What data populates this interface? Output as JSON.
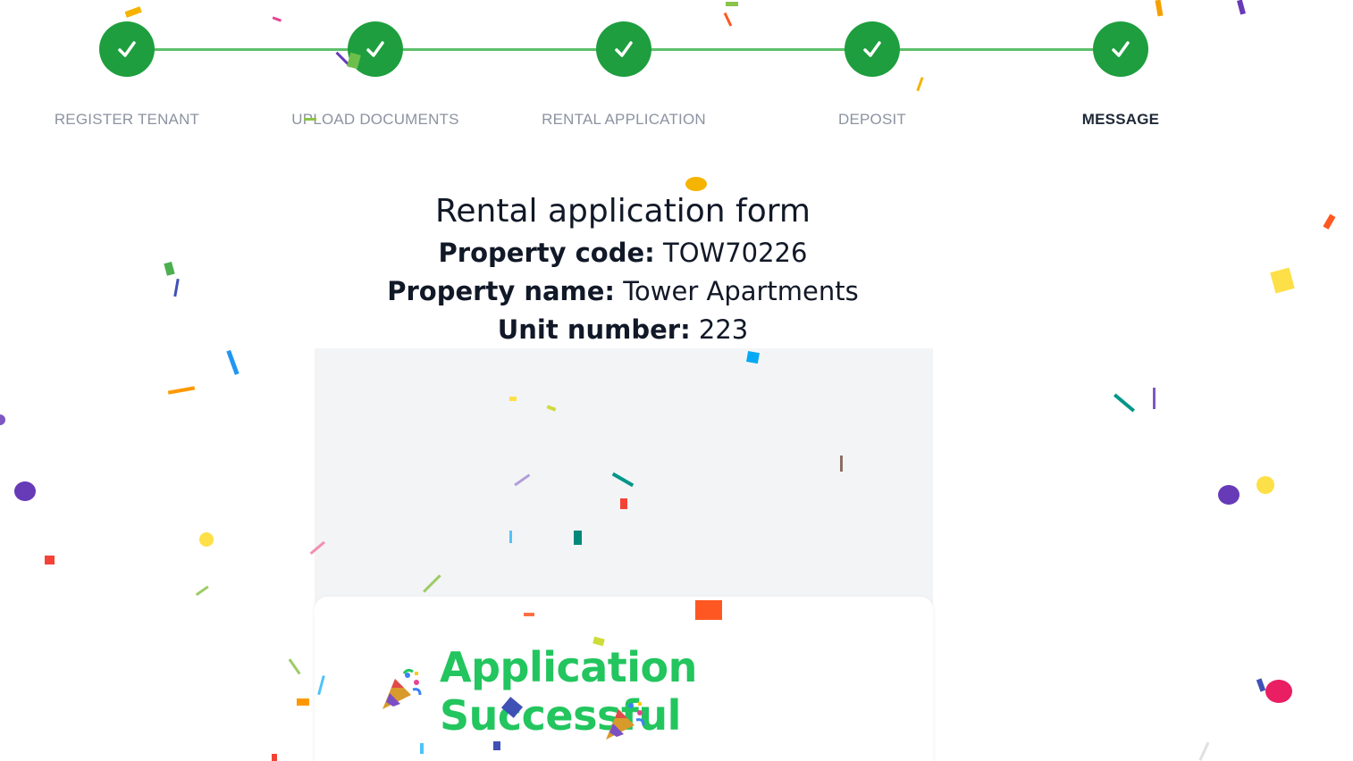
{
  "stepper": {
    "steps": [
      {
        "label": "REGISTER TENANT",
        "completed": true
      },
      {
        "label": "UPLOAD DOCUMENTS",
        "completed": true
      },
      {
        "label": "RENTAL APPLICATION",
        "completed": true
      },
      {
        "label": "DEPOSIT",
        "completed": true
      },
      {
        "label": "MESSAGE",
        "completed": true,
        "active": true
      }
    ],
    "check_glyph": "✓"
  },
  "form": {
    "title": "Rental application form",
    "property_code_label": "Property code:",
    "property_code": "TOW70226",
    "property_name_label": "Property name:",
    "property_name": "Tower Apartments",
    "unit_number_label": "Unit number:",
    "unit_number": "223"
  },
  "success": {
    "title": "Application Successful",
    "icon": "party-popper-icon"
  },
  "colors": {
    "step_complete": "#1e9e3e",
    "step_line": "#5cc06a",
    "success_text": "#22c55e",
    "panel_bg": "#f3f4f6"
  }
}
